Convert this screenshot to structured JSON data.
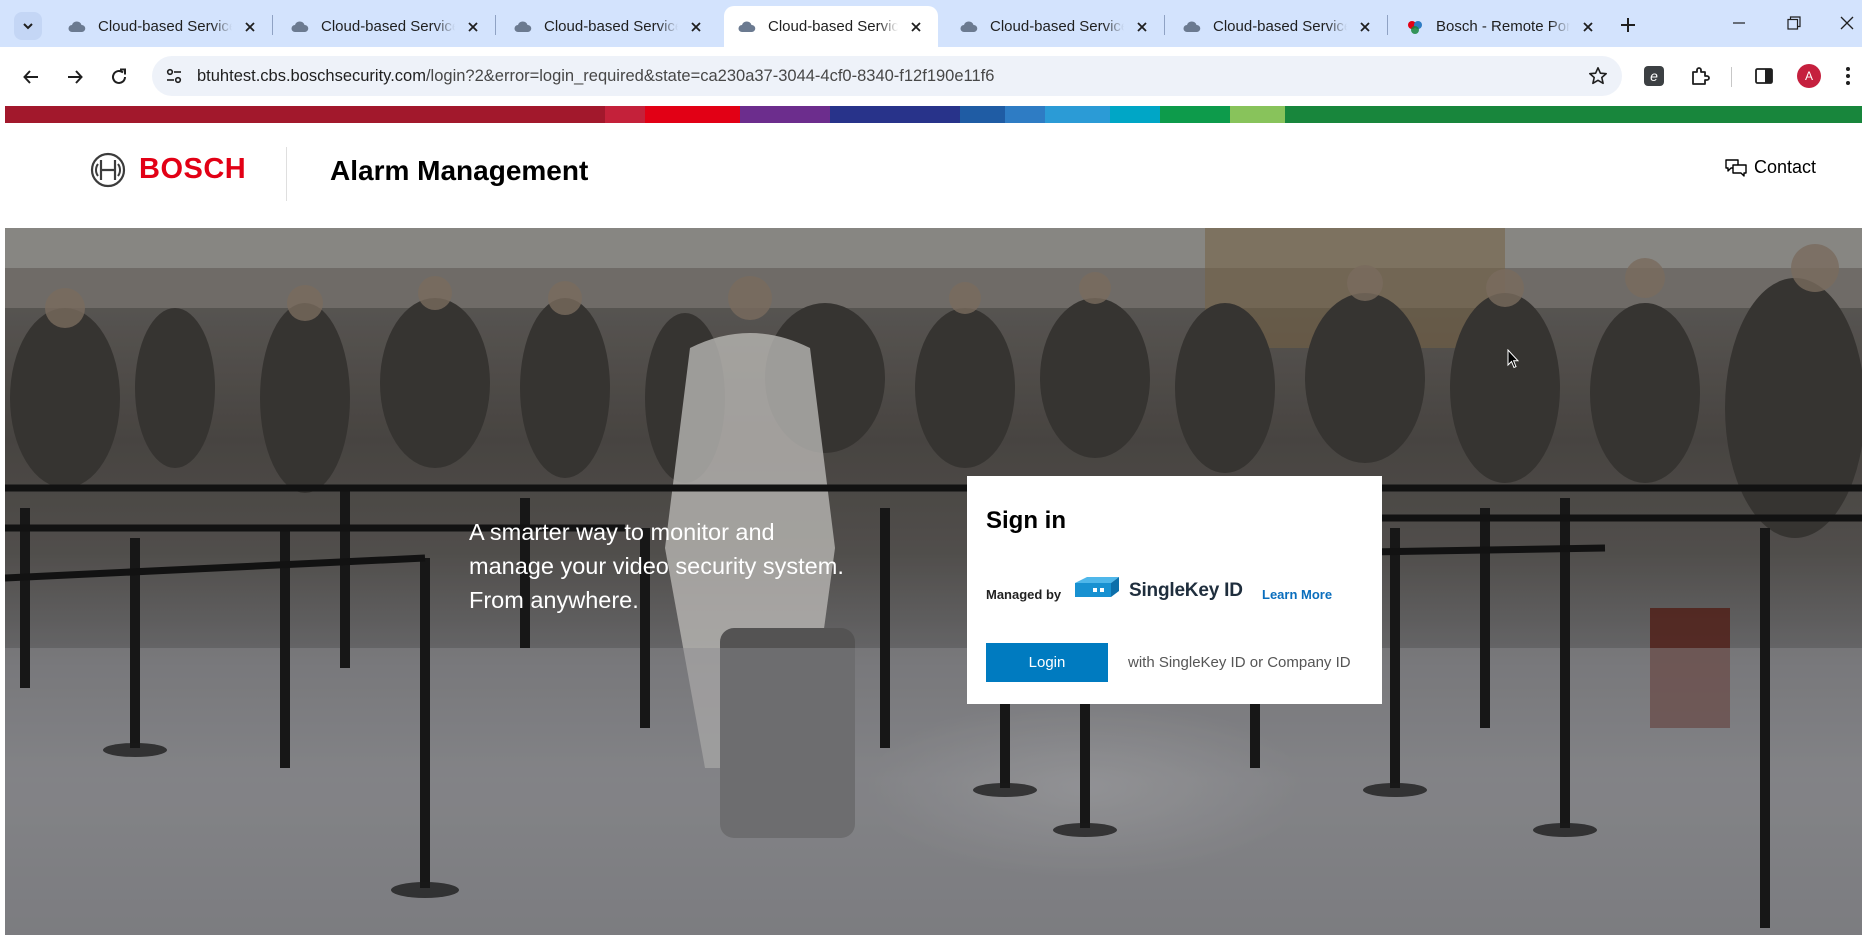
{
  "browser": {
    "tabs": [
      {
        "title": "Cloud-based Services",
        "active": false
      },
      {
        "title": "Cloud-based Services",
        "active": false
      },
      {
        "title": "Cloud-based Services",
        "active": false
      },
      {
        "title": "Cloud-based Services",
        "active": true
      },
      {
        "title": "Cloud-based Services",
        "active": false
      },
      {
        "title": "Cloud-based Services",
        "active": false
      },
      {
        "title": "Bosch - Remote Portal",
        "active": false
      }
    ],
    "new_tab_label": "+",
    "url_host": "btuhtest.cbs.boschsecurity.com",
    "url_path": "/login?2&error=login_required&state=ca230a37-3044-4cf0-8340-f12f190e11f6",
    "profile_initial": "A",
    "colors": {
      "tabbar": "#d3e3fd",
      "profile": "#c5203e"
    }
  },
  "header": {
    "brand": "BOSCH",
    "app_title": "Alarm Management",
    "contact_label": "Contact",
    "brand_color": "#e20015"
  },
  "supergraphic_colors": [
    "#9e1a2c",
    "#9e1a2c",
    "#c1202f",
    "#e20015",
    "#d01d3a",
    "#6c2d8d",
    "#3b2f86",
    "#1d3c8e",
    "#1b5a9e",
    "#2e7cc4",
    "#2b9bd6",
    "#00a6b3",
    "#0d9b4b",
    "#88c35b",
    "#18863c",
    "#18863c"
  ],
  "hero": {
    "tagline_lines": [
      "A smarter way to monitor and",
      "manage your video security system.",
      "From anywhere."
    ]
  },
  "signin": {
    "title": "Sign in",
    "managed_by": "Managed by",
    "provider": "SingleKey ID",
    "learn_more": "Learn More",
    "login_button": "Login",
    "login_note": "with SingleKey ID or Company ID",
    "button_color": "#007bc0"
  }
}
